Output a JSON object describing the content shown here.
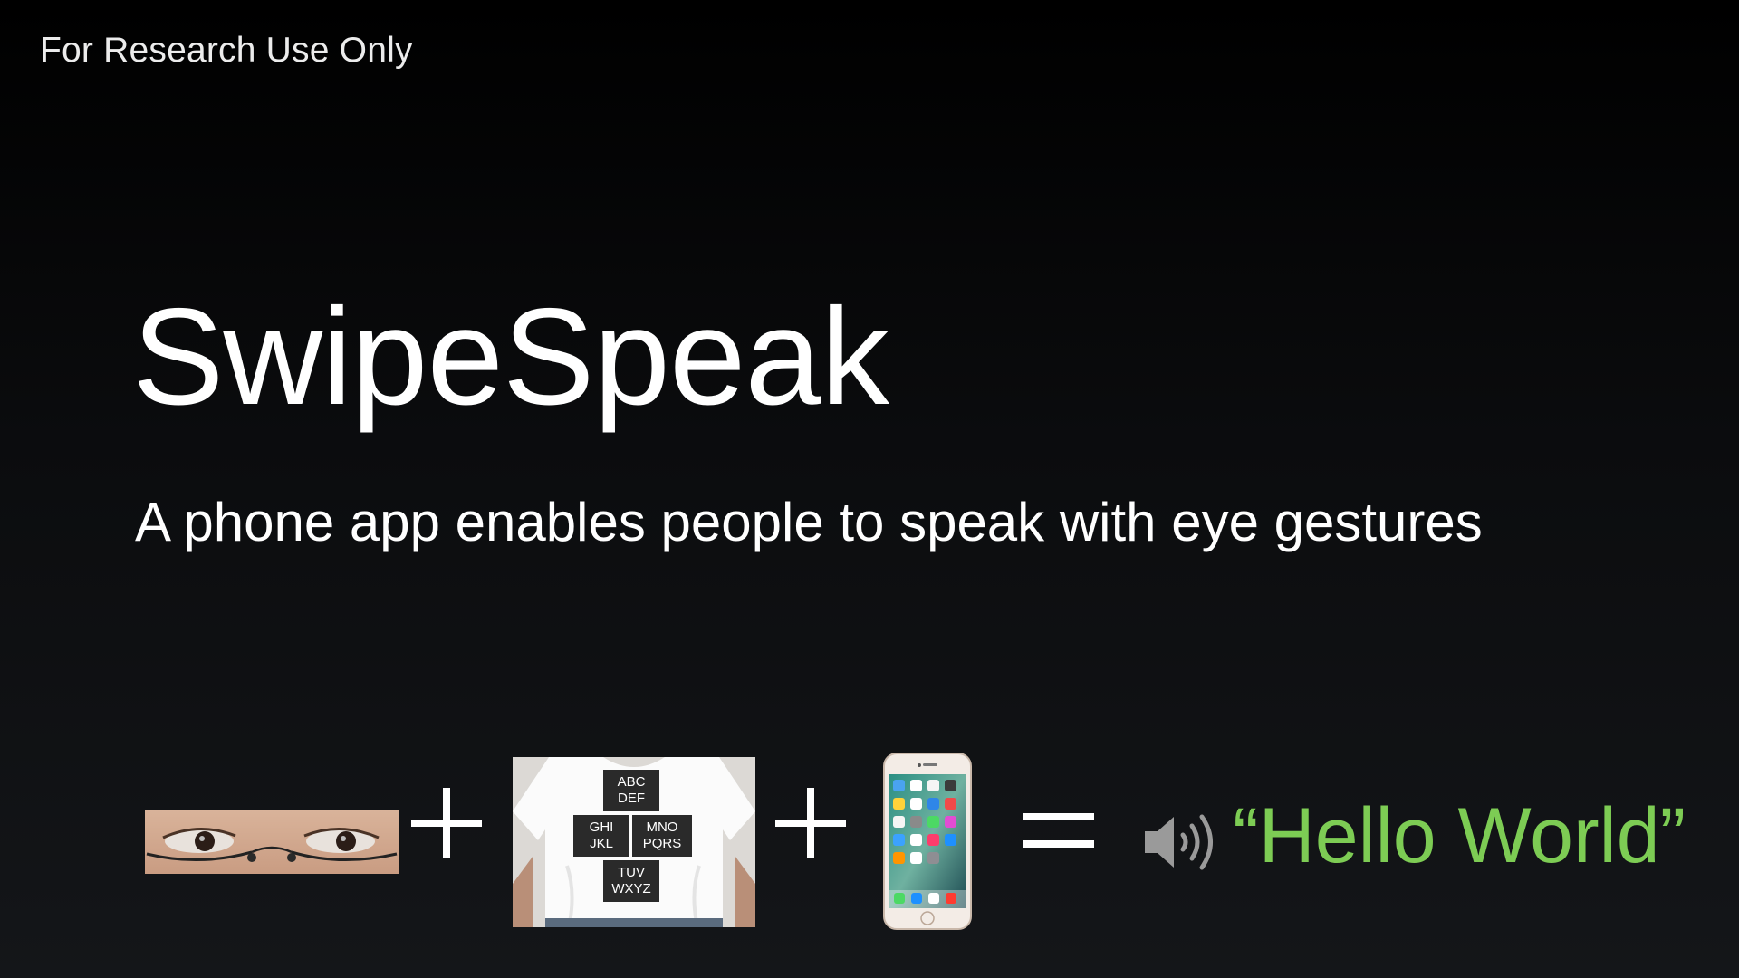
{
  "slide": {
    "disclaimer": "For Research Use Only",
    "title": "SwipeSpeak",
    "subtitle": "A phone app enables people to speak with eye gestures",
    "equation": {
      "plus": "+",
      "equals": "=",
      "output": "“Hello World”"
    },
    "shirt_board": {
      "top": "ABC\nDEF",
      "left": "GHI\nJKL",
      "right": "MNO\nPQRS",
      "bottom": "TUV\nWXYZ"
    },
    "icons": [
      "eyes-with-glasses-photo",
      "t-shirt-letter-board-photo",
      "smartphone-icon",
      "speaker-volume-icon"
    ],
    "colors": {
      "background": "#0b0c0e",
      "text": "#ffffff",
      "accent_green": "#7dcc54"
    }
  }
}
